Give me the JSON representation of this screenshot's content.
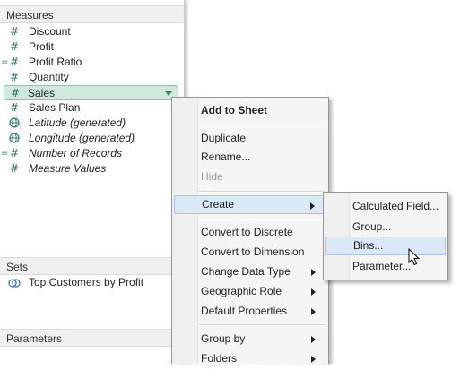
{
  "measures": {
    "header": "Measures",
    "fields": [
      {
        "label": "Discount",
        "icon": "hash-icon",
        "calc": false,
        "italic": false
      },
      {
        "label": "Profit",
        "icon": "hash-icon",
        "calc": false,
        "italic": false
      },
      {
        "label": "Profit Ratio",
        "icon": "hash-icon",
        "calc": true,
        "italic": false
      },
      {
        "label": "Quantity",
        "icon": "hash-icon",
        "calc": false,
        "italic": false
      },
      {
        "label": "Sales",
        "icon": "hash-icon",
        "calc": false,
        "italic": false,
        "selected": true
      },
      {
        "label": "Sales Plan",
        "icon": "hash-icon",
        "calc": false,
        "italic": false
      },
      {
        "label": "Latitude (generated)",
        "icon": "globe-icon",
        "calc": false,
        "italic": true
      },
      {
        "label": "Longitude (generated)",
        "icon": "globe-icon",
        "calc": false,
        "italic": true
      },
      {
        "label": "Number of Records",
        "icon": "hash-icon",
        "calc": true,
        "italic": true
      },
      {
        "label": "Measure Values",
        "icon": "hash-icon",
        "calc": false,
        "italic": true
      }
    ]
  },
  "sets": {
    "header": "Sets",
    "items": [
      {
        "label": "Top Customers by Profit",
        "icon": "set-icon"
      }
    ]
  },
  "parameters": {
    "header": "Parameters"
  },
  "context_menu": {
    "add_to_sheet": "Add to Sheet",
    "duplicate": "Duplicate",
    "rename": "Rename...",
    "hide": "Hide",
    "create": "Create",
    "convert_discrete": "Convert to Discrete",
    "convert_dimension": "Convert to Dimension",
    "change_data_type": "Change Data Type",
    "geographic_role": "Geographic Role",
    "default_properties": "Default Properties",
    "group_by": "Group by",
    "folders": "Folders"
  },
  "create_submenu": {
    "calculated_field": "Calculated Field...",
    "group": "Group...",
    "bins": "Bins...",
    "parameter": "Parameter..."
  },
  "colors": {
    "field_icon": "#2a6c6a",
    "selected_pill": "#cfe9dc",
    "menu_highlight": "#dbe8f7"
  }
}
